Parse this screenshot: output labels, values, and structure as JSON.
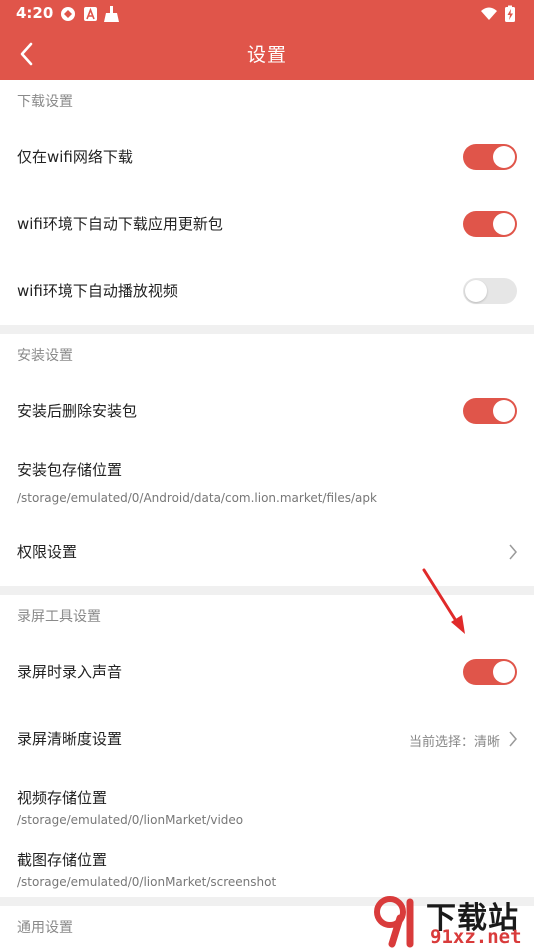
{
  "status_bar": {
    "time": "4:20",
    "icons": [
      "sync-icon",
      "app-a-icon",
      "cleaner-icon"
    ],
    "right_icons": [
      "wifi-icon",
      "battery-icon"
    ]
  },
  "app_bar": {
    "title": "设置",
    "back_icon": "chevron-left-icon",
    "background": "#e0554a"
  },
  "sections": {
    "download": {
      "header": "下载设置",
      "items": [
        {
          "label": "仅在wifi网络下载",
          "toggle": true
        },
        {
          "label": "wifi环境下自动下载应用更新包",
          "toggle": true
        },
        {
          "label": "wifi环境下自动播放视频",
          "toggle": false
        }
      ]
    },
    "install": {
      "header": "安装设置",
      "items": [
        {
          "label": "安装后删除安装包",
          "toggle": true
        },
        {
          "label": "安装包存储位置",
          "sub": "/storage/emulated/0/Android/data/com.lion.market/files/apk"
        },
        {
          "label": "权限设置"
        }
      ]
    },
    "recording": {
      "header": "录屏工具设置",
      "items": [
        {
          "label": "录屏时录入声音",
          "toggle": true
        },
        {
          "label": "录屏清晰度设置",
          "value": "当前选择：清晰"
        },
        {
          "label": "视频存储位置",
          "sub": "/storage/emulated/0/lionMarket/video"
        },
        {
          "label": "截图存储位置",
          "sub": "/storage/emulated/0/lionMarket/screenshot"
        }
      ]
    },
    "general": {
      "header": "通用设置"
    }
  },
  "watermark": {
    "site": "下载站",
    "domain": "91xz.net"
  },
  "colors": {
    "accent": "#e0554a",
    "toggle_off": "#e6e6e6",
    "section_divider": "#f0f0f0"
  }
}
